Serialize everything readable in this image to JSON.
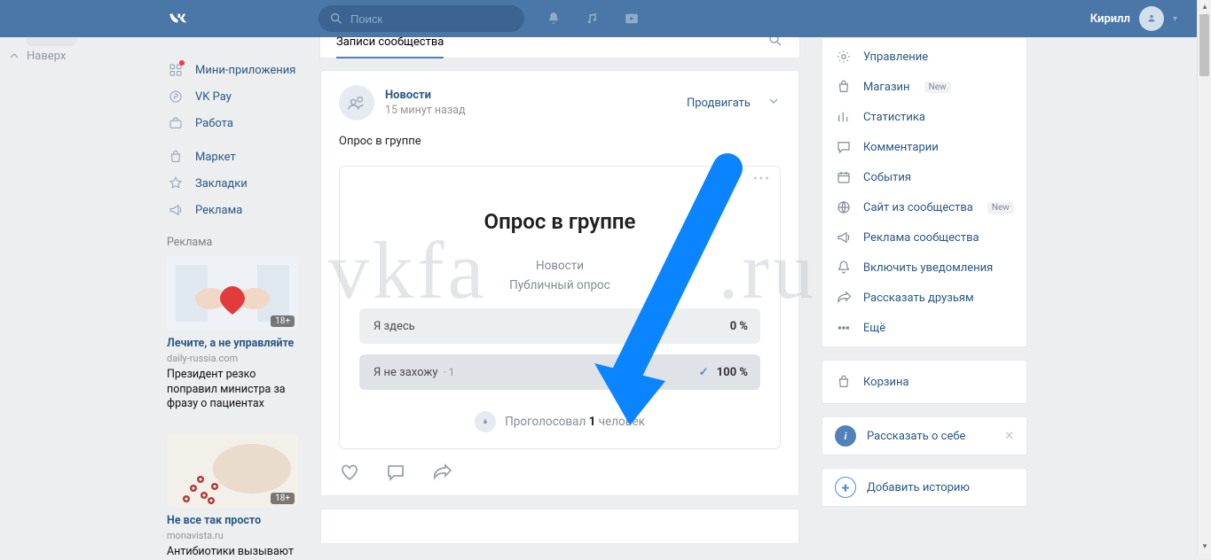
{
  "header": {
    "search_placeholder": "Поиск",
    "user_name": "Кирилл"
  },
  "backtop": "Наверх",
  "left_nav": {
    "items": [
      {
        "key": "mini-apps",
        "label": "Мини-приложения",
        "has_dot": true
      },
      {
        "key": "vk-pay",
        "label": "VK Pay"
      },
      {
        "key": "jobs",
        "label": "Работа"
      },
      {
        "key": "market",
        "label": "Маркет"
      },
      {
        "key": "bookmarks",
        "label": "Закладки"
      },
      {
        "key": "ads",
        "label": "Реклама"
      }
    ],
    "ads_heading": "Реклама",
    "ads": [
      {
        "tag": "18+",
        "title": "Лечите, а не управляйте",
        "domain": "daily-russia.com",
        "desc": "Президент резко поправил министра за фразу о пациентах"
      },
      {
        "tag": "18+",
        "title": "Не все так просто",
        "domain": "monavista.ru",
        "desc": "Антибиотики вызывают"
      }
    ]
  },
  "tabs": {
    "active": "Записи сообщества"
  },
  "post": {
    "source": "Новости",
    "time": "15 минут назад",
    "promote": "Продвигать",
    "text": "Опрос в группе"
  },
  "poll": {
    "title": "Опрос в группе",
    "source": "Новости",
    "type": "Публичный опрос",
    "options": [
      {
        "label": "Я здесь",
        "percent": "0 %"
      },
      {
        "label": "Я не захожу",
        "count": "1",
        "percent": "100 %",
        "selected": true
      }
    ],
    "footer_prefix": "Проголосовал",
    "footer_count": "1",
    "footer_suffix": "человек"
  },
  "right": {
    "items": [
      {
        "key": "manage",
        "label": "Управление"
      },
      {
        "key": "shop",
        "label": "Магазин",
        "new": true
      },
      {
        "key": "stats",
        "label": "Статистика"
      },
      {
        "key": "comments",
        "label": "Комментарии"
      },
      {
        "key": "events",
        "label": "События"
      },
      {
        "key": "site",
        "label": "Сайт из сообщества",
        "new": true
      },
      {
        "key": "community-ads",
        "label": "Реклама сообщества"
      },
      {
        "key": "notif",
        "label": "Включить уведомления"
      },
      {
        "key": "tell",
        "label": "Рассказать друзьям"
      },
      {
        "key": "more",
        "label": "Ещё"
      }
    ],
    "cart": "Корзина",
    "tip_about": "Рассказать о себе",
    "tip_story": "Добавить историю",
    "badge_new": "New"
  },
  "watermark": {
    "left": "vkfa",
    "right": ".ru"
  }
}
